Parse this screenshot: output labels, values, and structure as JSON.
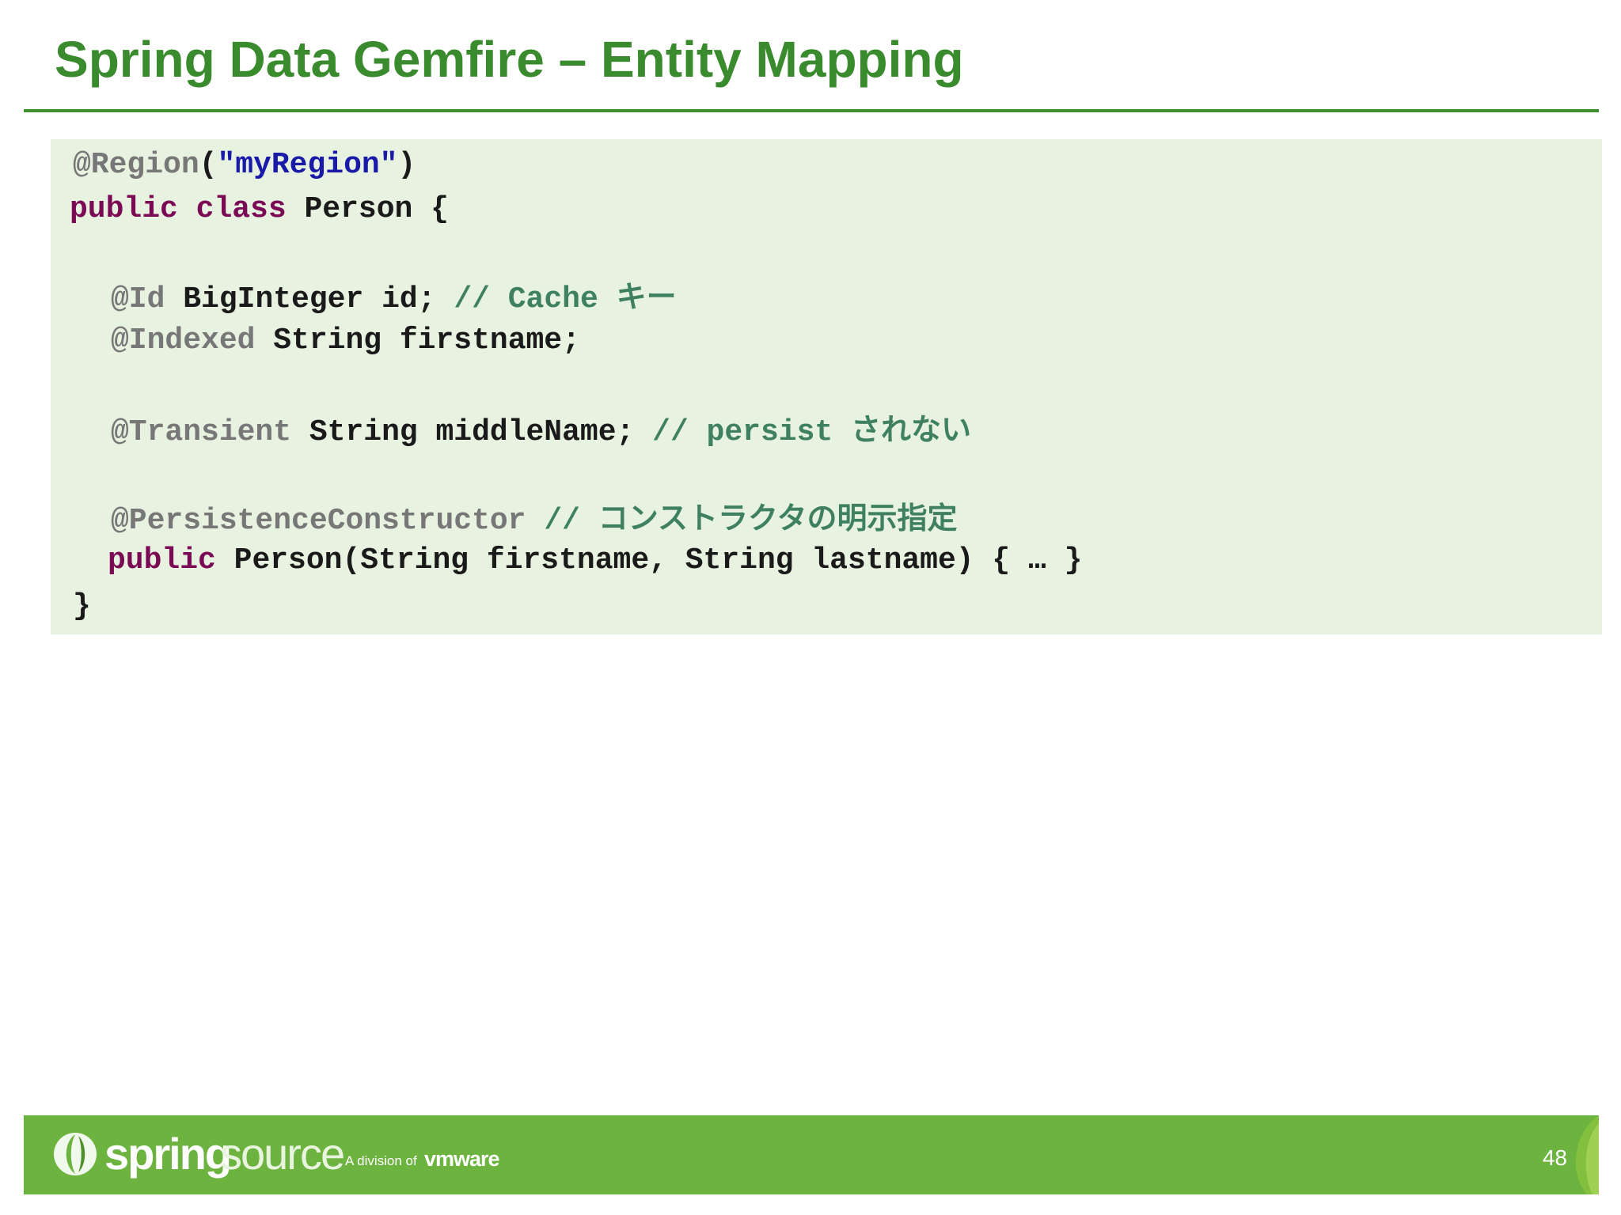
{
  "slide": {
    "title": "Spring Data Gemfire – Entity Mapping",
    "page_number": "48"
  },
  "code": {
    "line1": {
      "ann": "@Region",
      "paren_open": "(",
      "str": "\"myRegion\"",
      "paren_close": ")"
    },
    "line2": {
      "kw1": "public",
      "kw2": "class",
      "rest": "Person {"
    },
    "line3": {
      "ann": "@Id",
      "code": "BigInteger id;",
      "comment": "// Cache",
      "comment_cjk": "キー"
    },
    "line4": {
      "ann": "@Indexed",
      "code": "String firstname;"
    },
    "line5": {
      "ann": "@Transient",
      "code": "String middleName;",
      "comment": "// persist",
      "comment_cjk": "されない"
    },
    "line6": {
      "ann": "@PersistenceConstructor",
      "comment": "//",
      "comment_cjk": "コンストラクタの明示指定"
    },
    "line7": {
      "kw": "public",
      "code": "Person(String firstname, String lastname) { … }"
    },
    "line8": {
      "code": "}"
    }
  },
  "footer": {
    "brand_spring": "spring",
    "brand_source": "source",
    "division_text": "A division of",
    "vmware": "vmware",
    "logo_icon": "springsource-leaf-icon",
    "colors": {
      "footer_bg": "#6db33f",
      "title": "#3a8a2e",
      "code_bg": "#e7f2e1"
    }
  }
}
